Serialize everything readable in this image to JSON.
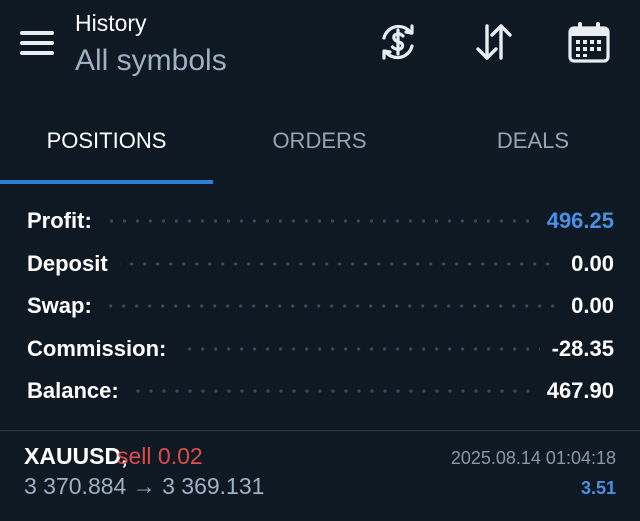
{
  "header": {
    "title": "History",
    "subtitle": "All symbols",
    "icons": [
      "menu-icon",
      "currency-exchange-icon",
      "sort-arrows-icon",
      "calendar-icon"
    ]
  },
  "tabs": [
    {
      "label": "POSITIONS",
      "active": true
    },
    {
      "label": "ORDERS",
      "active": false
    },
    {
      "label": "DEALS",
      "active": false
    }
  ],
  "summary": [
    {
      "label": "Profit:",
      "value": "496.25"
    },
    {
      "label": "Deposit",
      "value": "0.00"
    },
    {
      "label": "Swap:",
      "value": "0.00"
    },
    {
      "label": "Commission:",
      "value": "-28.35"
    },
    {
      "label": "Balance:",
      "value": "467.90"
    }
  ],
  "trade": {
    "symbol": "XAUUSD,",
    "side": "sell 0.02",
    "prices": "3 370.884 → 3 369.131",
    "time": "2025.08.14 01:04:18",
    "profit": "3.51"
  },
  "colors": {
    "background": "#0f1923",
    "accent": "#2b7ed8",
    "profit_blue": "#4a90e2",
    "sell_red": "#e04a4a"
  }
}
